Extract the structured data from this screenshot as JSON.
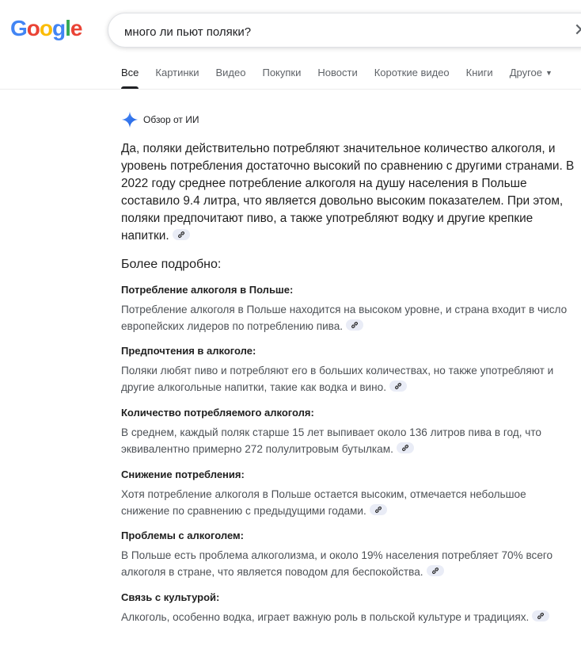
{
  "logo": {
    "letters": [
      "G",
      "o",
      "o",
      "g",
      "l",
      "e"
    ],
    "colors": [
      "#4285F4",
      "#EA4335",
      "#FBBC05",
      "#4285F4",
      "#34A853",
      "#EA4335"
    ]
  },
  "search": {
    "query": "много ли пьют поляки?"
  },
  "tabs": [
    {
      "label": "Все",
      "active": true
    },
    {
      "label": "Картинки"
    },
    {
      "label": "Видео"
    },
    {
      "label": "Покупки"
    },
    {
      "label": "Новости"
    },
    {
      "label": "Короткие видео"
    },
    {
      "label": "Книги"
    },
    {
      "label": "Другое"
    }
  ],
  "ai_overview": {
    "label": "Обзор от ИИ",
    "summary": "Да, поляки действительно потребляют значительное количество алкоголя, и уровень потребления достаточно высокий по сравнению с другими странами. В 2022 году среднее потребление алкоголя на душу населения в Польше составило 9.4 литра, что является довольно высоким показателем. При этом, поляки предпочитают пиво, а также употребляют водку и другие крепкие напитки.",
    "more_label": "Более подробно:",
    "sections": [
      {
        "title": "Потребление алкоголя в Польше:",
        "text": "Потребление алкоголя в Польше находится на высоком уровне, и страна входит в число европейских лидеров по потреблению пива."
      },
      {
        "title": "Предпочтения в алкоголе:",
        "text": "Поляки любят пиво и потребляют его в больших количествах, но также употребляют и другие алкогольные напитки, такие как водка и вино."
      },
      {
        "title": "Количество потребляемого алкоголя:",
        "text": "В среднем, каждый поляк старше 15 лет выпивает около 136 литров пива в год, что эквивалентно примерно 272 полулитровым бутылкам."
      },
      {
        "title": "Снижение потребления:",
        "text": "Хотя потребление алкоголя в Польше остается высоким, отмечается небольшое снижение по сравнению с предыдущими годами."
      },
      {
        "title": "Проблемы с алкоголем:",
        "text": "В Польше есть проблема алкоголизма, и около 19% населения потребляет 70% всего алкоголя в стране, что является поводом для беспокойства."
      },
      {
        "title": "Связь с культурой:",
        "text": "Алкоголь, особенно водка, играет важную роль в польской культуре и традициях."
      }
    ]
  }
}
